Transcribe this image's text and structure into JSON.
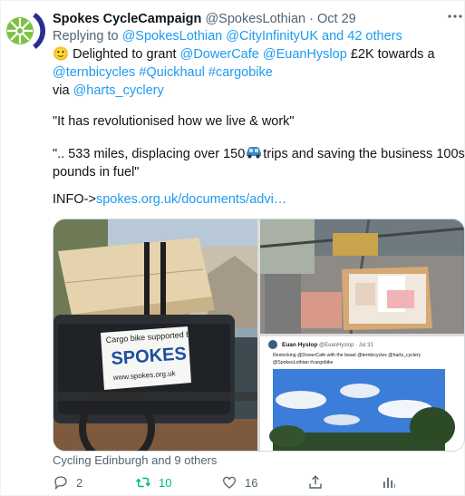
{
  "tweet": {
    "author_name": "Spokes CycleCampaign",
    "handle": "@SpokesLothian",
    "separator": "·",
    "date": "Oct 29",
    "more_icon": "more-horizontal-icon",
    "reply_prefix": "Replying to",
    "reply_targets": "@SpokesLothian @CityInfinityUK and 42 others",
    "emoji": "🙂",
    "line1_text": "Delighted to grant",
    "line1_mention1": "@DowerCafe",
    "line1_mention2": "@EuanHyslop",
    "line1_tail": "£2K towards a",
    "line2_mention": "@ternbicycles",
    "line2_tag1": "#Quickhaul",
    "line2_tag2": "#cargobike",
    "line3_prefix": "via",
    "line3_mention": "@harts_cyclery",
    "quote1": "\"It has revolutionised how we live & work\"",
    "quote2_start": "\".. 533 miles, displacing over 150",
    "quote2_car_icon": "car-emoji-icon",
    "quote2_end": "trips and saving the business 100s of",
    "quote2_line2": "pounds in fuel\"",
    "info_prefix": "INFO->",
    "info_link": "spokes.org.uk/documents/advi…"
  },
  "media": {
    "left_image": {
      "sign_line1": "Cargo bike supported by",
      "sign_logo": "SPOKES",
      "sign_url": "www.spokes.org.uk"
    },
    "right_bottom_image": {
      "embedded_name": "Euan Hyslop",
      "embedded_handle": "@EuanHyslop · Jul 31",
      "embedded_text_line1": "Restocking @DowerCafe with the beast @ternbicycles @harts_cyclery",
      "embedded_text_line2": "@SpokesLothian #cargobike"
    }
  },
  "footer": {
    "tagged": "Cycling Edinburgh and 9 others"
  },
  "actions": {
    "reply_count": "2",
    "retweet_count": "10",
    "like_count": "16",
    "share_label": "",
    "analytics_label": ""
  },
  "colors": {
    "link": "#1d9bf0",
    "muted": "#536471",
    "retweeted": "#00ba7c",
    "text": "#0f1419"
  }
}
